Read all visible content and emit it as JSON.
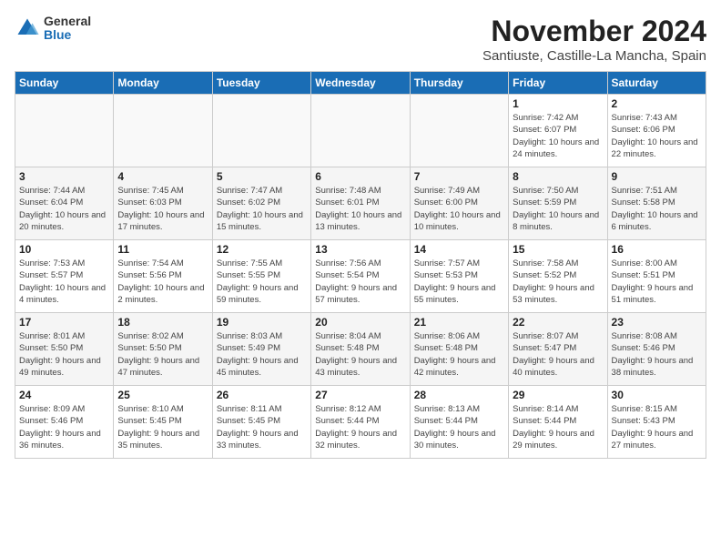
{
  "logo": {
    "general": "General",
    "blue": "Blue"
  },
  "title": "November 2024",
  "subtitle": "Santiuste, Castille-La Mancha, Spain",
  "headers": [
    "Sunday",
    "Monday",
    "Tuesday",
    "Wednesday",
    "Thursday",
    "Friday",
    "Saturday"
  ],
  "weeks": [
    [
      {
        "day": "",
        "info": ""
      },
      {
        "day": "",
        "info": ""
      },
      {
        "day": "",
        "info": ""
      },
      {
        "day": "",
        "info": ""
      },
      {
        "day": "",
        "info": ""
      },
      {
        "day": "1",
        "info": "Sunrise: 7:42 AM\nSunset: 6:07 PM\nDaylight: 10 hours and 24 minutes."
      },
      {
        "day": "2",
        "info": "Sunrise: 7:43 AM\nSunset: 6:06 PM\nDaylight: 10 hours and 22 minutes."
      }
    ],
    [
      {
        "day": "3",
        "info": "Sunrise: 7:44 AM\nSunset: 6:04 PM\nDaylight: 10 hours and 20 minutes."
      },
      {
        "day": "4",
        "info": "Sunrise: 7:45 AM\nSunset: 6:03 PM\nDaylight: 10 hours and 17 minutes."
      },
      {
        "day": "5",
        "info": "Sunrise: 7:47 AM\nSunset: 6:02 PM\nDaylight: 10 hours and 15 minutes."
      },
      {
        "day": "6",
        "info": "Sunrise: 7:48 AM\nSunset: 6:01 PM\nDaylight: 10 hours and 13 minutes."
      },
      {
        "day": "7",
        "info": "Sunrise: 7:49 AM\nSunset: 6:00 PM\nDaylight: 10 hours and 10 minutes."
      },
      {
        "day": "8",
        "info": "Sunrise: 7:50 AM\nSunset: 5:59 PM\nDaylight: 10 hours and 8 minutes."
      },
      {
        "day": "9",
        "info": "Sunrise: 7:51 AM\nSunset: 5:58 PM\nDaylight: 10 hours and 6 minutes."
      }
    ],
    [
      {
        "day": "10",
        "info": "Sunrise: 7:53 AM\nSunset: 5:57 PM\nDaylight: 10 hours and 4 minutes."
      },
      {
        "day": "11",
        "info": "Sunrise: 7:54 AM\nSunset: 5:56 PM\nDaylight: 10 hours and 2 minutes."
      },
      {
        "day": "12",
        "info": "Sunrise: 7:55 AM\nSunset: 5:55 PM\nDaylight: 9 hours and 59 minutes."
      },
      {
        "day": "13",
        "info": "Sunrise: 7:56 AM\nSunset: 5:54 PM\nDaylight: 9 hours and 57 minutes."
      },
      {
        "day": "14",
        "info": "Sunrise: 7:57 AM\nSunset: 5:53 PM\nDaylight: 9 hours and 55 minutes."
      },
      {
        "day": "15",
        "info": "Sunrise: 7:58 AM\nSunset: 5:52 PM\nDaylight: 9 hours and 53 minutes."
      },
      {
        "day": "16",
        "info": "Sunrise: 8:00 AM\nSunset: 5:51 PM\nDaylight: 9 hours and 51 minutes."
      }
    ],
    [
      {
        "day": "17",
        "info": "Sunrise: 8:01 AM\nSunset: 5:50 PM\nDaylight: 9 hours and 49 minutes."
      },
      {
        "day": "18",
        "info": "Sunrise: 8:02 AM\nSunset: 5:50 PM\nDaylight: 9 hours and 47 minutes."
      },
      {
        "day": "19",
        "info": "Sunrise: 8:03 AM\nSunset: 5:49 PM\nDaylight: 9 hours and 45 minutes."
      },
      {
        "day": "20",
        "info": "Sunrise: 8:04 AM\nSunset: 5:48 PM\nDaylight: 9 hours and 43 minutes."
      },
      {
        "day": "21",
        "info": "Sunrise: 8:06 AM\nSunset: 5:48 PM\nDaylight: 9 hours and 42 minutes."
      },
      {
        "day": "22",
        "info": "Sunrise: 8:07 AM\nSunset: 5:47 PM\nDaylight: 9 hours and 40 minutes."
      },
      {
        "day": "23",
        "info": "Sunrise: 8:08 AM\nSunset: 5:46 PM\nDaylight: 9 hours and 38 minutes."
      }
    ],
    [
      {
        "day": "24",
        "info": "Sunrise: 8:09 AM\nSunset: 5:46 PM\nDaylight: 9 hours and 36 minutes."
      },
      {
        "day": "25",
        "info": "Sunrise: 8:10 AM\nSunset: 5:45 PM\nDaylight: 9 hours and 35 minutes."
      },
      {
        "day": "26",
        "info": "Sunrise: 8:11 AM\nSunset: 5:45 PM\nDaylight: 9 hours and 33 minutes."
      },
      {
        "day": "27",
        "info": "Sunrise: 8:12 AM\nSunset: 5:44 PM\nDaylight: 9 hours and 32 minutes."
      },
      {
        "day": "28",
        "info": "Sunrise: 8:13 AM\nSunset: 5:44 PM\nDaylight: 9 hours and 30 minutes."
      },
      {
        "day": "29",
        "info": "Sunrise: 8:14 AM\nSunset: 5:44 PM\nDaylight: 9 hours and 29 minutes."
      },
      {
        "day": "30",
        "info": "Sunrise: 8:15 AM\nSunset: 5:43 PM\nDaylight: 9 hours and 27 minutes."
      }
    ]
  ]
}
